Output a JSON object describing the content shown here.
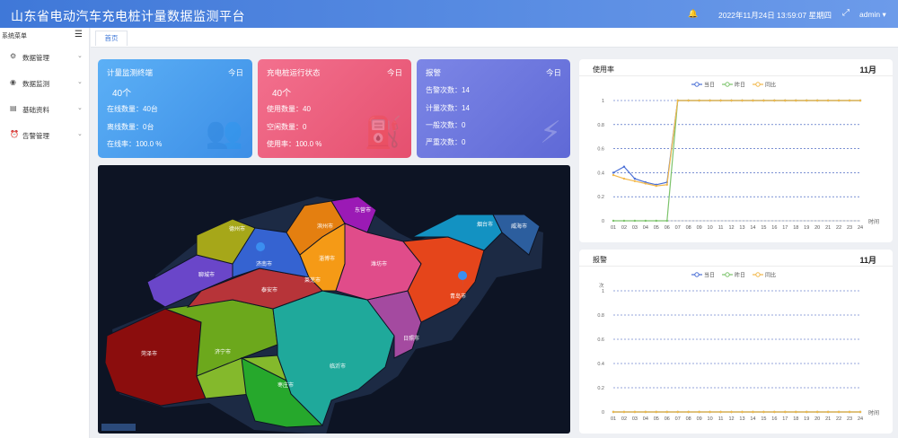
{
  "header": {
    "title": "山东省电动汽车充电桩计量数据监测平台",
    "bell_icon": "bell-icon",
    "datetime": "2022年11月24日 13:59:07 星期四",
    "fullscreen_icon": "fullscreen-icon",
    "user": "admin ▾"
  },
  "sidebar": {
    "title": "系统菜单",
    "toggle_icon": "menu-toggle-icon",
    "items": [
      {
        "label": "数据管理",
        "icon": "settings-icon"
      },
      {
        "label": "数据监测",
        "icon": "eye-icon"
      },
      {
        "label": "基础资料",
        "icon": "document-icon"
      },
      {
        "label": "告警管理",
        "icon": "alarm-icon"
      }
    ]
  },
  "tabs": [
    {
      "label": "首页"
    }
  ],
  "cards": [
    {
      "title": "计量监测终端",
      "tag": "今日",
      "big": "40个",
      "lines": [
        "在线数量：40台",
        "离线数量：0台",
        "在线率：100.0 %"
      ],
      "icon": "person-icon",
      "colors": [
        "#5cb0f6",
        "#3c8ee6"
      ]
    },
    {
      "title": "充电桩运行状态",
      "tag": "今日",
      "big": "40个",
      "lines": [
        "使用数量：40",
        "空闲数量：0",
        "使用率：100.0 %"
      ],
      "icon": "charger-icon",
      "colors": [
        "#f3708e",
        "#e5506f"
      ]
    },
    {
      "title": "报警",
      "tag": "今日",
      "lines": [
        "告警次数：14",
        "计量次数：14",
        "一般次数：0",
        "严重次数：0"
      ],
      "icon": "alert-icon",
      "colors": [
        "#7c86e6",
        "#5f69d6"
      ]
    }
  ],
  "map": {
    "cities": [
      "滨州市",
      "东营市",
      "德州市",
      "淄博市",
      "潍坊市",
      "烟台市",
      "威海市",
      "聊城市",
      "济南市",
      "莱芜市",
      "泰安市",
      "青岛市",
      "日照市",
      "临沂市",
      "济宁市",
      "菏泽市",
      "枣庄市"
    ],
    "logo": "map-logo"
  },
  "charts": [
    {
      "title": "使用率",
      "month": "11月",
      "chart_data": {
        "type": "line",
        "x": [
          "01",
          "02",
          "03",
          "04",
          "05",
          "06",
          "07",
          "08",
          "09",
          "10",
          "11",
          "12",
          "13",
          "14",
          "15",
          "16",
          "17",
          "18",
          "19",
          "20",
          "21",
          "22",
          "23",
          "24"
        ],
        "xlabel": "时间",
        "ylim": [
          0,
          1
        ],
        "yticks": [
          "0",
          "0.2",
          "0.4",
          "0.6",
          "0.8",
          "1"
        ],
        "series": [
          {
            "name": "当日",
            "color": "#4a6fd6",
            "values": [
              0.4,
              0.45,
              0.35,
              0.32,
              0.3,
              0.32,
              1,
              1,
              1,
              1,
              1,
              1,
              1,
              1,
              1,
              1,
              1,
              1,
              1,
              1,
              1,
              1,
              1,
              1
            ]
          },
          {
            "name": "昨日",
            "color": "#7cc36b",
            "values": [
              0,
              0,
              0,
              0,
              0,
              0,
              1,
              1,
              1,
              1,
              1,
              1,
              1,
              1,
              1,
              1,
              1,
              1,
              1,
              1,
              1,
              1,
              1,
              1
            ]
          },
          {
            "name": "同比",
            "color": "#f2b84b",
            "values": [
              0.38,
              0.35,
              0.33,
              0.31,
              0.29,
              0.3,
              1,
              1,
              1,
              1,
              1,
              1,
              1,
              1,
              1,
              1,
              1,
              1,
              1,
              1,
              1,
              1,
              1,
              1
            ]
          }
        ]
      }
    },
    {
      "title": "报警",
      "month": "11月",
      "chart_data": {
        "type": "line",
        "x": [
          "01",
          "02",
          "03",
          "04",
          "05",
          "06",
          "07",
          "08",
          "09",
          "10",
          "11",
          "12",
          "13",
          "14",
          "15",
          "16",
          "17",
          "18",
          "19",
          "20",
          "21",
          "22",
          "23",
          "24"
        ],
        "xlabel": "时间",
        "ylabel": "次",
        "ylim": [
          0,
          1
        ],
        "yticks": [
          "0",
          "0.2",
          "0.4",
          "0.6",
          "0.8",
          "1"
        ],
        "series": [
          {
            "name": "当日",
            "color": "#4a6fd6",
            "values": [
              0,
              0,
              0,
              0,
              0,
              0,
              0,
              0,
              0,
              0,
              0,
              0,
              0,
              0,
              0,
              0,
              0,
              0,
              0,
              0,
              0,
              0,
              0,
              0
            ]
          },
          {
            "name": "昨日",
            "color": "#7cc36b",
            "values": [
              0,
              0,
              0,
              0,
              0,
              0,
              0,
              0,
              0,
              0,
              0,
              0,
              0,
              0,
              0,
              0,
              0,
              0,
              0,
              0,
              0,
              0,
              0,
              0
            ]
          },
          {
            "name": "同比",
            "color": "#f2b84b",
            "values": [
              0,
              0,
              0,
              0,
              0,
              0,
              0,
              0,
              0,
              0,
              0,
              0,
              0,
              0,
              0,
              0,
              0,
              0,
              0,
              0,
              0,
              0,
              0,
              0
            ]
          }
        ]
      }
    }
  ]
}
